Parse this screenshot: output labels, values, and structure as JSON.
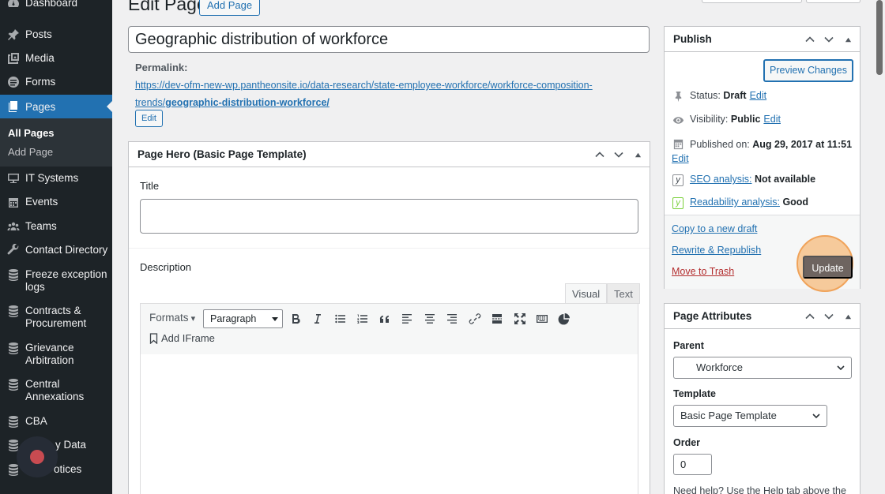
{
  "sidebar": {
    "items": [
      {
        "label": "Dashboard",
        "icon": "dashboard-icon"
      },
      {
        "label": "Posts",
        "icon": "pin-icon"
      },
      {
        "label": "Media",
        "icon": "media-icon"
      },
      {
        "label": "Forms",
        "icon": "forms-icon"
      },
      {
        "label": "Pages",
        "icon": "pages-icon",
        "active": true
      },
      {
        "label": "IT Systems",
        "icon": "desktop-icon"
      },
      {
        "label": "Events",
        "icon": "calendar-icon"
      },
      {
        "label": "Teams",
        "icon": "groups-icon"
      },
      {
        "label": "Contact Directory",
        "icon": "tool-icon"
      },
      {
        "label": "Freeze exception logs",
        "icon": "database-icon"
      },
      {
        "label": "Contracts & Procurement",
        "icon": "database-icon"
      },
      {
        "label": "Grievance Arbitration",
        "icon": "database-icon"
      },
      {
        "label": "Central Annexations",
        "icon": "database-icon"
      },
      {
        "label": "CBA",
        "icon": "database-icon"
      },
      {
        "label": "y Data",
        "icon": "database-icon"
      },
      {
        "label": "otices",
        "icon": "database-icon"
      }
    ],
    "submenu": [
      {
        "label": "All Pages",
        "current": true
      },
      {
        "label": "Add Page",
        "current": false
      }
    ]
  },
  "header": {
    "title": "Edit Page",
    "add_page_label": "Add Page"
  },
  "post": {
    "title": "Geographic distribution of workforce",
    "permalink_label": "Permalink:",
    "permalink_base": "https://dev-ofm-new-wp.pantheonsite.io/data-research/state-employee-workforce/workforce-composition-trends/",
    "permalink_slug": "geographic-distribution-workforce/",
    "permalink_edit": "Edit"
  },
  "hero": {
    "heading": "Page Hero (Basic Page Template)",
    "title_label": "Title",
    "title_value": "",
    "description_label": "Description",
    "tab_visual": "Visual",
    "tab_text": "Text",
    "formats_label": "Formats",
    "paragraph_value": "Paragraph",
    "add_iframe_label": "Add IFrame"
  },
  "publish": {
    "heading": "Publish",
    "preview_label": "Preview Changes",
    "status_label": "Status:",
    "status_value": "Draft",
    "visibility_label": "Visibility:",
    "visibility_value": "Public",
    "published_label": "Published on:",
    "published_value": "Aug 29, 2017 at 11:51",
    "edit_label": "Edit",
    "seo_label": "SEO analysis:",
    "seo_value": "Not available",
    "readability_label": "Readability analysis:",
    "readability_value": "Good",
    "copy_draft": "Copy to a new draft",
    "rewrite": "Rewrite & Republish",
    "trash": "Move to Trash",
    "update_label": "Update"
  },
  "attributes": {
    "heading": "Page Attributes",
    "parent_label": "Parent",
    "parent_value": "Workforce",
    "template_label": "Template",
    "template_value": "Basic Page Template",
    "order_label": "Order",
    "order_value": "0",
    "help_text": "Need help? Use the Help tab above the"
  },
  "colors": {
    "sidebar_bg": "#1d2327",
    "accent": "#2271b1",
    "highlight": "#f0a35a",
    "trash": "#b32d2e"
  }
}
